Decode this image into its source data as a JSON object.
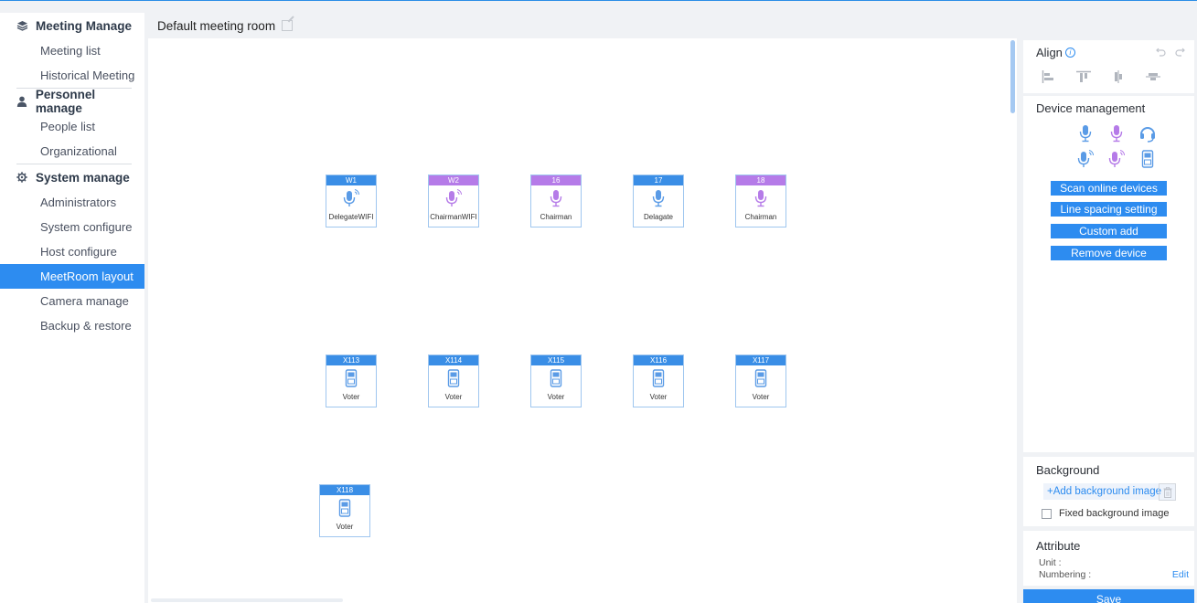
{
  "sidebar": {
    "sections": [
      {
        "title": "Meeting Manage",
        "icon": "layers-icon",
        "items": [
          "Meeting list",
          "Historical Meeting"
        ]
      },
      {
        "title": "Personnel manage",
        "icon": "user-icon",
        "items": [
          "People list",
          "Organizational"
        ]
      },
      {
        "title": "System manage",
        "icon": "gear-icon",
        "items": [
          "Administrators",
          "System configure",
          "Host configure",
          "MeetRoom layout",
          "Camera manage",
          "Backup & restore"
        ]
      }
    ],
    "active_item": "MeetRoom layout"
  },
  "header": {
    "room_title": "Default meeting room"
  },
  "canvas": {
    "devices": [
      {
        "tag": "W1",
        "label": "DelegateWIFI",
        "type": "delegate-wifi-mic",
        "color": "blue"
      },
      {
        "tag": "W2",
        "label": "ChairmanWIFI",
        "type": "chairman-wifi-mic",
        "color": "purple"
      },
      {
        "tag": "16",
        "label": "Chairman",
        "type": "chairman-mic",
        "color": "purple"
      },
      {
        "tag": "17",
        "label": "Delagate",
        "type": "delegate-mic",
        "color": "blue"
      },
      {
        "tag": "18",
        "label": "Chairman",
        "type": "chairman-mic",
        "color": "purple"
      },
      {
        "tag": "X113",
        "label": "Voter",
        "type": "voter",
        "color": "blue"
      },
      {
        "tag": "X114",
        "label": "Voter",
        "type": "voter",
        "color": "blue"
      },
      {
        "tag": "X115",
        "label": "Voter",
        "type": "voter",
        "color": "blue"
      },
      {
        "tag": "X116",
        "label": "Voter",
        "type": "voter",
        "color": "blue"
      },
      {
        "tag": "X117",
        "label": "Voter",
        "type": "voter",
        "color": "blue"
      },
      {
        "tag": "X118",
        "label": "Voter",
        "type": "voter",
        "color": "blue"
      }
    ]
  },
  "align_panel": {
    "title": "Align"
  },
  "device_panel": {
    "title": "Device management",
    "buttons": {
      "scan": "Scan online devices",
      "spacing": "Line spacing setting",
      "custom_add": "Custom add",
      "remove": "Remove device"
    }
  },
  "background_panel": {
    "title": "Background",
    "add_label": "+Add background image",
    "fixed_label": "Fixed background image"
  },
  "attribute_panel": {
    "title": "Attribute",
    "unit_label": "Unit :",
    "numbering_label": "Numbering :",
    "edit_label": "Edit"
  },
  "save_label": "Save",
  "colors": {
    "primary": "#2d8cf0",
    "tag_blue": "#3a8ee6",
    "tag_purple": "#b57be8",
    "mic_blue": "#5a9be6",
    "mic_purple": "#b57be8"
  }
}
